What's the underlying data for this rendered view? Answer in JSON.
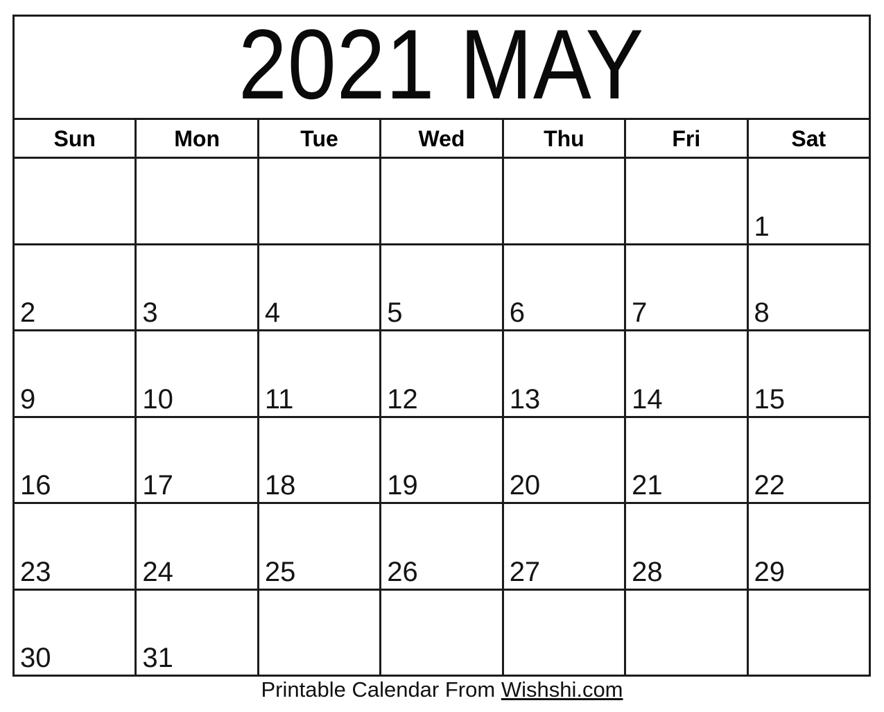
{
  "calendar": {
    "title": "2021 MAY",
    "year": "2021",
    "month": "MAY",
    "weekday_headers": [
      {
        "label": "Sun"
      },
      {
        "label": "Mon"
      },
      {
        "label": "Tue"
      },
      {
        "label": "Wed"
      },
      {
        "label": "Thu"
      },
      {
        "label": "Fri"
      },
      {
        "label": "Sat"
      }
    ],
    "weeks": [
      {
        "days": [
          {
            "number": ""
          },
          {
            "number": ""
          },
          {
            "number": ""
          },
          {
            "number": ""
          },
          {
            "number": ""
          },
          {
            "number": ""
          },
          {
            "number": "1"
          }
        ]
      },
      {
        "days": [
          {
            "number": "2"
          },
          {
            "number": "3"
          },
          {
            "number": "4"
          },
          {
            "number": "5"
          },
          {
            "number": "6"
          },
          {
            "number": "7"
          },
          {
            "number": "8"
          }
        ]
      },
      {
        "days": [
          {
            "number": "9"
          },
          {
            "number": "10"
          },
          {
            "number": "11"
          },
          {
            "number": "12"
          },
          {
            "number": "13"
          },
          {
            "number": "14"
          },
          {
            "number": "15"
          }
        ]
      },
      {
        "days": [
          {
            "number": "16"
          },
          {
            "number": "17"
          },
          {
            "number": "18"
          },
          {
            "number": "19"
          },
          {
            "number": "20"
          },
          {
            "number": "21"
          },
          {
            "number": "22"
          }
        ]
      },
      {
        "days": [
          {
            "number": "23"
          },
          {
            "number": "24"
          },
          {
            "number": "25"
          },
          {
            "number": "26"
          },
          {
            "number": "27"
          },
          {
            "number": "28"
          },
          {
            "number": "29"
          }
        ]
      },
      {
        "days": [
          {
            "number": "30"
          },
          {
            "number": "31"
          },
          {
            "number": ""
          },
          {
            "number": ""
          },
          {
            "number": ""
          },
          {
            "number": ""
          },
          {
            "number": ""
          }
        ]
      }
    ]
  },
  "footer": {
    "prefix": "Printable Calendar From ",
    "link_text": "Wishshi.com"
  },
  "colors": {
    "border": "#1c1c1c",
    "text": "#111111",
    "background": "#ffffff"
  }
}
